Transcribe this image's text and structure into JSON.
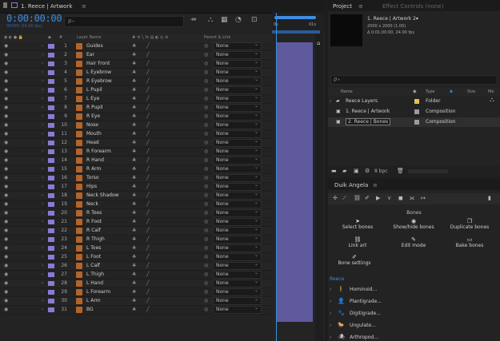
{
  "timeline": {
    "tab_title": "1. Reece | Artwork",
    "menu_glyph": "≡",
    "timecode": "0:00:00:00",
    "subtime": "00000 (24.00 fps)",
    "search_glyph": "ρ₊",
    "ruler_start": "0s",
    "ruler_end": "01s",
    "headers": {
      "layer_name": "Layer Name",
      "switches": "♣ ✲ ╲ fx ▤ ◐ ◎ ⊕",
      "parent_link": "Parent & Link"
    },
    "parent_value": "None",
    "layers": [
      {
        "num": "1",
        "name": "Guides"
      },
      {
        "num": "2",
        "name": "Ear"
      },
      {
        "num": "3",
        "name": "Hair Front"
      },
      {
        "num": "4",
        "name": "L Eyebrow"
      },
      {
        "num": "5",
        "name": "R Eyebrow"
      },
      {
        "num": "6",
        "name": "L Pupil"
      },
      {
        "num": "7",
        "name": "L Eye"
      },
      {
        "num": "8",
        "name": "R Pupil"
      },
      {
        "num": "9",
        "name": "R Eye"
      },
      {
        "num": "10",
        "name": "Nose"
      },
      {
        "num": "11",
        "name": "Mouth"
      },
      {
        "num": "12",
        "name": "Head"
      },
      {
        "num": "13",
        "name": "R Forearm"
      },
      {
        "num": "14",
        "name": "R Hand"
      },
      {
        "num": "15",
        "name": "R Arm"
      },
      {
        "num": "16",
        "name": "Torso"
      },
      {
        "num": "17",
        "name": "Hips"
      },
      {
        "num": "18",
        "name": "Neck Shadow"
      },
      {
        "num": "19",
        "name": "Neck"
      },
      {
        "num": "20",
        "name": "R Toes"
      },
      {
        "num": "21",
        "name": "R Foot"
      },
      {
        "num": "22",
        "name": "R Calf"
      },
      {
        "num": "23",
        "name": "R Thigh"
      },
      {
        "num": "24",
        "name": "L Toes"
      },
      {
        "num": "25",
        "name": "L Foot"
      },
      {
        "num": "26",
        "name": "L Calf"
      },
      {
        "num": "27",
        "name": "L Thigh"
      },
      {
        "num": "28",
        "name": "L Hand"
      },
      {
        "num": "29",
        "name": "L Forearm"
      },
      {
        "num": "30",
        "name": "L Arm"
      },
      {
        "num": "31",
        "name": "BG"
      }
    ]
  },
  "project": {
    "tab_project": "Project",
    "tab_effects": "Effect Controls (none)",
    "comp_title": "1. Reece | Artwork 2▾",
    "comp_size": "2000 x 2000 (1.00)",
    "comp_duration": "Δ 0:01:00:00, 24.00 fps",
    "col_name": "Name",
    "col_type": "Type",
    "col_size": "Size",
    "col_media": "Me",
    "items": [
      {
        "name": "Reece Layers",
        "type": "Folder",
        "color": "#e6c24a"
      },
      {
        "name": "1. Reece | Artwork",
        "type": "Composition",
        "color": "#9c9c9c"
      },
      {
        "name": "2. Reece | Bones",
        "type": "Composition",
        "color": "#9c9c9c"
      }
    ],
    "bpc": "8 bpc"
  },
  "duik": {
    "tab": "Duik Angela",
    "section": "Bones",
    "buttons": [
      {
        "label": "Select bones",
        "icon": "➤"
      },
      {
        "label": "Show/hide bones",
        "icon": "◉"
      },
      {
        "label": "Duplicate bones",
        "icon": "❐"
      },
      {
        "label": "Link art",
        "icon": "⛓"
      },
      {
        "label": "Edit mode",
        "icon": "✎"
      },
      {
        "label": "Bake bones",
        "icon": "▭"
      },
      {
        "label": "Bone settings",
        "icon": "✐"
      }
    ],
    "rig_group": "Reece",
    "rigs": [
      "Hominoid...",
      "Plantigrade...",
      "Digitigrade...",
      "Ungulate...",
      "Arthropod..."
    ]
  }
}
